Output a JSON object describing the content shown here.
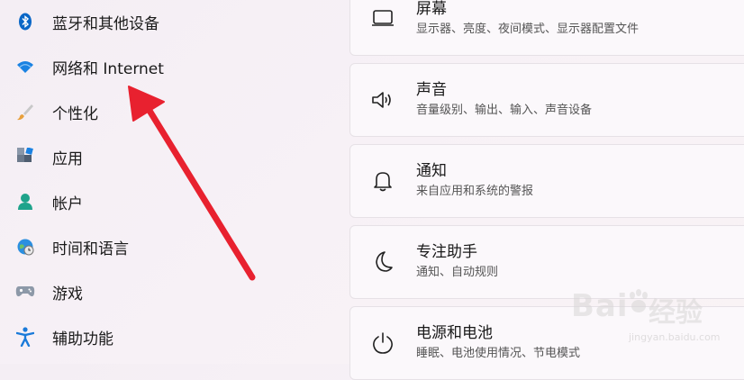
{
  "sidebar": {
    "items": [
      {
        "label": "蓝牙和其他设备",
        "icon": "bluetooth-icon"
      },
      {
        "label": "网络和 Internet",
        "icon": "wifi-icon"
      },
      {
        "label": "个性化",
        "icon": "brush-icon"
      },
      {
        "label": "应用",
        "icon": "apps-icon"
      },
      {
        "label": "帐户",
        "icon": "account-icon"
      },
      {
        "label": "时间和语言",
        "icon": "globe-clock-icon"
      },
      {
        "label": "游戏",
        "icon": "gamepad-icon"
      },
      {
        "label": "辅助功能",
        "icon": "accessibility-icon"
      }
    ]
  },
  "main": {
    "cards": [
      {
        "title": "屏幕",
        "subtitle": "显示器、亮度、夜间模式、显示器配置文件",
        "icon": "monitor-icon"
      },
      {
        "title": "声音",
        "subtitle": "音量级别、输出、输入、声音设备",
        "icon": "speaker-icon"
      },
      {
        "title": "通知",
        "subtitle": "来自应用和系统的警报",
        "icon": "bell-icon"
      },
      {
        "title": "专注助手",
        "subtitle": "通知、自动规则",
        "icon": "moon-icon"
      },
      {
        "title": "电源和电池",
        "subtitle": "睡眠、电池使用情况、节电模式",
        "icon": "power-icon"
      }
    ]
  },
  "annotation": {
    "color": "#e8212f"
  },
  "watermark": {
    "brand": "Bai",
    "brand2": "经验",
    "url": "jingyan.baidu.com"
  }
}
